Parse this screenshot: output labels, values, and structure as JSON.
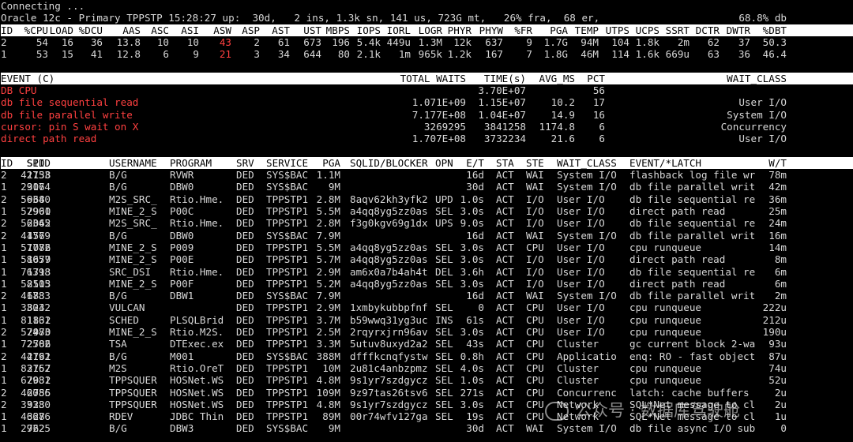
{
  "connecting": "Connecting ...",
  "status": {
    "left": "Oracle 12c - Primary TPPSTP 15:28:27 up:  30d,   2 ins, 1.3k sn, 141 us, 723G mt,   26% fra,  68 er,",
    "right": "68.8% db"
  },
  "inst_headers": [
    "ID",
    "%CPU",
    "LOAD",
    "%DCU",
    "AAS",
    "ASC",
    "ASI",
    "ASW",
    "ASP",
    "AST",
    "UST",
    "MBPS",
    "IOPS",
    "IORL",
    "LOGR",
    "PHYR",
    "PHYW",
    "%FR",
    "PGA",
    "TEMP",
    "UTPS",
    "UCPS",
    "SSRT",
    "DCTR",
    "DWTR",
    "%DBT"
  ],
  "inst_rows": [
    [
      "2",
      "54",
      "16",
      "36",
      "13.8",
      "10",
      "10",
      "43",
      "2",
      "61",
      "673",
      "196",
      "5.4k",
      "449u",
      "1.3M",
      "12k",
      "637",
      "9",
      "1.7G",
      "94M",
      "104",
      "1.8k",
      "2m",
      "62",
      "37",
      "50.3"
    ],
    [
      "1",
      "53",
      "15",
      "41",
      "12.8",
      "6",
      "9",
      "21",
      "3",
      "34",
      "644",
      "80",
      "2.1k",
      "1m",
      "965k",
      "1.2k",
      "167",
      "7",
      "1.8G",
      "46M",
      "114",
      "1.6k",
      "669u",
      "63",
      "36",
      "46.4"
    ]
  ],
  "event_headers": [
    "EVENT (C)",
    "TOTAL WAITS",
    "TIME(s)",
    "AVG_MS",
    "PCT",
    "WAIT_CLASS"
  ],
  "event_rows": [
    [
      "DB CPU",
      "",
      "3.70E+07",
      "",
      "56",
      ""
    ],
    [
      "db file sequential read",
      "1.071E+09",
      "1.15E+07",
      "10.2",
      "17",
      "User I/O"
    ],
    [
      "db file parallel write",
      "7.177E+08",
      "1.04E+07",
      "14.9",
      "16",
      "System I/O"
    ],
    [
      "cursor: pin S wait on X",
      "3269295",
      "3841258",
      "1174.8",
      "6",
      "Concurrency"
    ],
    [
      "direct path read",
      "1.707E+08",
      "3732234",
      "21.6",
      "6",
      "User I/O"
    ]
  ],
  "sess_headers": [
    "ID",
    "SID",
    "SPID",
    "USERNAME",
    "PROGRAM",
    "SRV",
    "SERVICE",
    "PGA",
    "SQLID/BLOCKER",
    "OPN",
    "E/T",
    "STA",
    "STE",
    "WAIT_CLASS",
    "EVENT/*LATCH",
    "W/T"
  ],
  "sess_rows": [
    [
      "2",
      "1138",
      "42753",
      "B/G",
      "RVWR",
      "DED",
      "SYS$BAC",
      "1.1M",
      "",
      "",
      "16d",
      "ACT",
      "WAI",
      "System I/O",
      "flashback log file wr",
      "78m"
    ],
    [
      "1",
      "306",
      "29174",
      "B/G",
      "DBW0",
      "DED",
      "SYS$BAC",
      "9M",
      "",
      "",
      "30d",
      "ACT",
      "WAI",
      "System I/O",
      "db file parallel writ",
      "42m"
    ],
    [
      "2",
      "968",
      "56340",
      "M2S_SRC_",
      "Rtio.Hme.",
      "DED",
      "TPPSTP1",
      "2.8M",
      "8aqv62kh3yfk2",
      "UPD",
      "1.0s",
      "ACT",
      "I/O",
      "User I/O",
      "db file sequential re",
      "36m"
    ],
    [
      "1",
      "2960",
      "57901",
      "MINE_2_S",
      "P00C",
      "DED",
      "TPPSTP1",
      "5.5M",
      "a4qq8yg5zz0as",
      "SEL",
      "3.0s",
      "ACT",
      "I/O",
      "User I/O",
      "direct path read",
      "25m"
    ],
    [
      "2",
      "2062",
      "56345",
      "M2S_SRC_",
      "Rtio.Hme.",
      "DED",
      "TPPSTP1",
      "2.8M",
      "f3g0kgv69g1dx",
      "UPS",
      "9.0s",
      "ACT",
      "I/O",
      "User I/O",
      "db file sequential re",
      "24m"
    ],
    [
      "2",
      "456",
      "41779",
      "B/G",
      "DBW0",
      "DED",
      "SYS$BAC",
      "7.9M",
      "",
      "",
      "16d",
      "ACT",
      "WAI",
      "System I/O",
      "db file parallel writ",
      "16m"
    ],
    [
      "1",
      "1086",
      "57772",
      "MINE_2_S",
      "P009",
      "DED",
      "TPPSTP1",
      "5.5M",
      "a4qq8yg5zz0as",
      "SEL",
      "3.0s",
      "ACT",
      "CPU",
      "User I/O",
      "cpu runqueue",
      "14m"
    ],
    [
      "1",
      "1679",
      "58057",
      "MINE_2_S",
      "P00E",
      "DED",
      "TPPSTP1",
      "5.7M",
      "a4qq8yg5zz0as",
      "SEL",
      "3.0s",
      "ACT",
      "I/O",
      "User I/O",
      "direct path read",
      "8m"
    ],
    [
      "1",
      "1713",
      "76398",
      "SRC_DSI",
      "Rtio.Hme.",
      "DED",
      "TPPSTP1",
      "2.9M",
      "am6x0a7b4ah4t",
      "DEL",
      "3.6h",
      "ACT",
      "I/O",
      "User I/O",
      "db file sequential re",
      "6m"
    ],
    [
      "1",
      "2503",
      "58115",
      "MINE_2_S",
      "P00F",
      "DED",
      "TPPSTP1",
      "5.2M",
      "a4qq8yg5zz0as",
      "SEL",
      "3.0s",
      "ACT",
      "I/O",
      "User I/O",
      "direct path read",
      "6m"
    ],
    [
      "2",
      "683",
      "41783",
      "B/G",
      "DBW1",
      "DED",
      "SYS$BAC",
      "7.9M",
      "",
      "",
      "16d",
      "ACT",
      "WAI",
      "System I/O",
      "db file parallel writ",
      "2m"
    ],
    [
      "1",
      "824",
      "33032",
      "VULCAN",
      "",
      "DED",
      "TPPSTP1",
      "2.9M",
      "1xmbykubbpfnf",
      "SEL",
      "0",
      "ACT",
      "CPU",
      "User I/O",
      "cpu runqueue",
      "222u"
    ],
    [
      "1",
      "1832",
      "81161",
      "SCHED",
      "PLSQLBrid",
      "DED",
      "TPPSTP1",
      "3.7M",
      "b59wwq31yg3uc",
      "INS",
      "61s",
      "ACT",
      "CPU",
      "User I/O",
      "cpu runqueue",
      "212u"
    ],
    [
      "2",
      "2970",
      "57483",
      "MINE_2_S",
      "Rtio.M2S.",
      "DED",
      "TPPSTP1",
      "2.5M",
      "2rqyrxjrn96av",
      "SEL",
      "3.0s",
      "ACT",
      "CPU",
      "User I/O",
      "cpu runqueue",
      "190u"
    ],
    [
      "1",
      "2786",
      "72502",
      "TSA",
      "DTExec.ex",
      "DED",
      "TPPSTP1",
      "3.3M",
      "5utuv8uxyd2a2",
      "SEL",
      "43s",
      "ACT",
      "CPU",
      "Cluster",
      "gc current block 2-wa",
      "93u"
    ],
    [
      "2",
      "2761",
      "44192",
      "B/G",
      "M001",
      "DED",
      "SYS$BAC",
      "388M",
      "dfffkcnqfystw",
      "SEL",
      "0.8h",
      "ACT",
      "CPU",
      "Applicatio",
      "enq: RO - fast object",
      "87u"
    ],
    [
      "1",
      "2757",
      "83162",
      "M2S",
      "Rtio.OreT",
      "DED",
      "TPPSTP1",
      "10M",
      "2u81c4anbzpmz",
      "SEL",
      "4.0s",
      "ACT",
      "CPU",
      "Cluster",
      "cpu runqueue",
      "74u"
    ],
    [
      "1",
      "2032",
      "67981",
      "TPPSQUER",
      "HOSNet.WS",
      "DED",
      "TPPSTP1",
      "4.8M",
      "9s1yr7szdgycz",
      "SEL",
      "1.0s",
      "ACT",
      "CPU",
      "Cluster",
      "cpu runqueue",
      "52u"
    ],
    [
      "2",
      "2755",
      "46086",
      "TPPSQUER",
      "HOSNet.WS",
      "DED",
      "TPPSTP1",
      "109M",
      "9z97tas26tsv6",
      "SEL",
      "271s",
      "ACT",
      "CPU",
      "Concurrenc",
      "latch: cache buffers",
      "2u"
    ],
    [
      "2",
      "923",
      "33380",
      "TPPSQUER",
      "HOSNet.WS",
      "DED",
      "TPPSTP1",
      "4.8M",
      "9s1yr7szdgycz",
      "SEL",
      "3.0s",
      "ACT",
      "CPU",
      "Network",
      "SQL*Net message to cl",
      "2u"
    ],
    [
      "1",
      "328",
      "46676",
      "RDEV",
      "JDBC Thin",
      "DED",
      "TPPSTP1",
      "89M",
      "00r74wfv127ga",
      "SEL",
      "19s",
      "ACT",
      "CPU",
      "Network",
      "SQL*Net message to cl",
      "1u"
    ],
    [
      "1",
      "762",
      "29225",
      "B/G",
      "DBW3",
      "DED",
      "SYS$BAC",
      "9M",
      "",
      "",
      "30d",
      "ACT",
      "WAI",
      "System I/O",
      "db file async I/O sub",
      "0"
    ]
  ],
  "watermark": "公众号 · 数据库驾驶舱"
}
